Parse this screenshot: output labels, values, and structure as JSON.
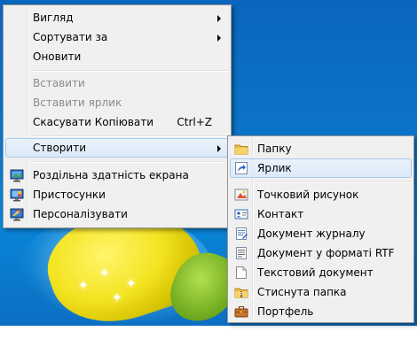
{
  "main_menu": {
    "items": [
      {
        "label": "Вигляд",
        "submenu": true
      },
      {
        "label": "Сортувати за",
        "submenu": true
      },
      {
        "label": "Оновити"
      },
      {
        "label": "Вставити",
        "disabled": true
      },
      {
        "label": "Вставити ярлик",
        "disabled": true
      },
      {
        "label": "Скасувати Копіювати",
        "shortcut": "Ctrl+Z"
      },
      {
        "label": "Створити",
        "submenu": true,
        "highlighted": true
      },
      {
        "label": "Роздільна здатність екрана",
        "icon": "display-resolution-icon"
      },
      {
        "label": "Пристосунки",
        "icon": "gadgets-icon"
      },
      {
        "label": "Персоналізувати",
        "icon": "personalize-icon"
      }
    ]
  },
  "new_submenu": {
    "items": [
      {
        "label": "Папку",
        "icon": "folder-icon"
      },
      {
        "label": "Ярлик",
        "icon": "shortcut-icon",
        "highlighted": true
      },
      {
        "label": "Точковий рисунок",
        "icon": "bitmap-icon"
      },
      {
        "label": "Контакт",
        "icon": "contact-icon"
      },
      {
        "label": "Документ журналу",
        "icon": "journal-document-icon"
      },
      {
        "label": "Документ у форматі RTF",
        "icon": "rtf-document-icon"
      },
      {
        "label": "Текстовий документ",
        "icon": "text-document-icon"
      },
      {
        "label": "Стиснута папка",
        "icon": "zip-folder-icon"
      },
      {
        "label": "Портфель",
        "icon": "briefcase-icon"
      }
    ]
  }
}
